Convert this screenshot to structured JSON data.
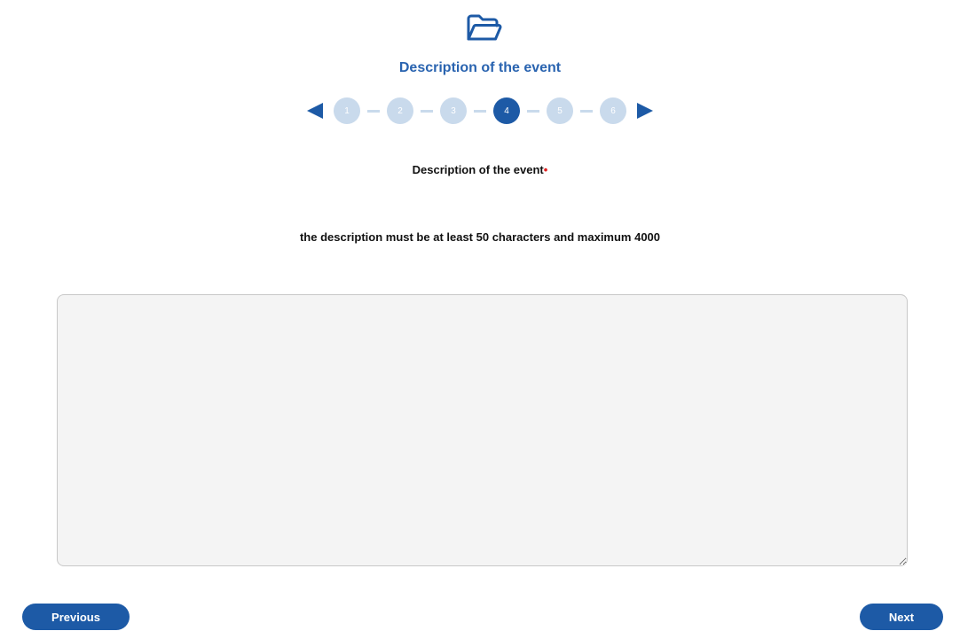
{
  "header": {
    "icon": "folder-open-icon",
    "title": "Description of the event"
  },
  "stepper": {
    "steps": [
      "1",
      "2",
      "3",
      "4",
      "5",
      "6"
    ],
    "current_step": 4,
    "prev_icon": "triangle-left-icon",
    "next_icon": "triangle-right-icon"
  },
  "form": {
    "label": "Description of the event",
    "required_marker": "•",
    "hint": "the description must be at least 50 characters and maximum 4000",
    "description_value": "",
    "description_placeholder": ""
  },
  "footer": {
    "previous_label": "Previous",
    "next_label": "Next"
  },
  "colors": {
    "primary": "#1d5aa6",
    "title": "#2a64b0",
    "step_inactive": "#c9daec",
    "required": "#e02020",
    "input_bg": "#f4f4f4"
  }
}
